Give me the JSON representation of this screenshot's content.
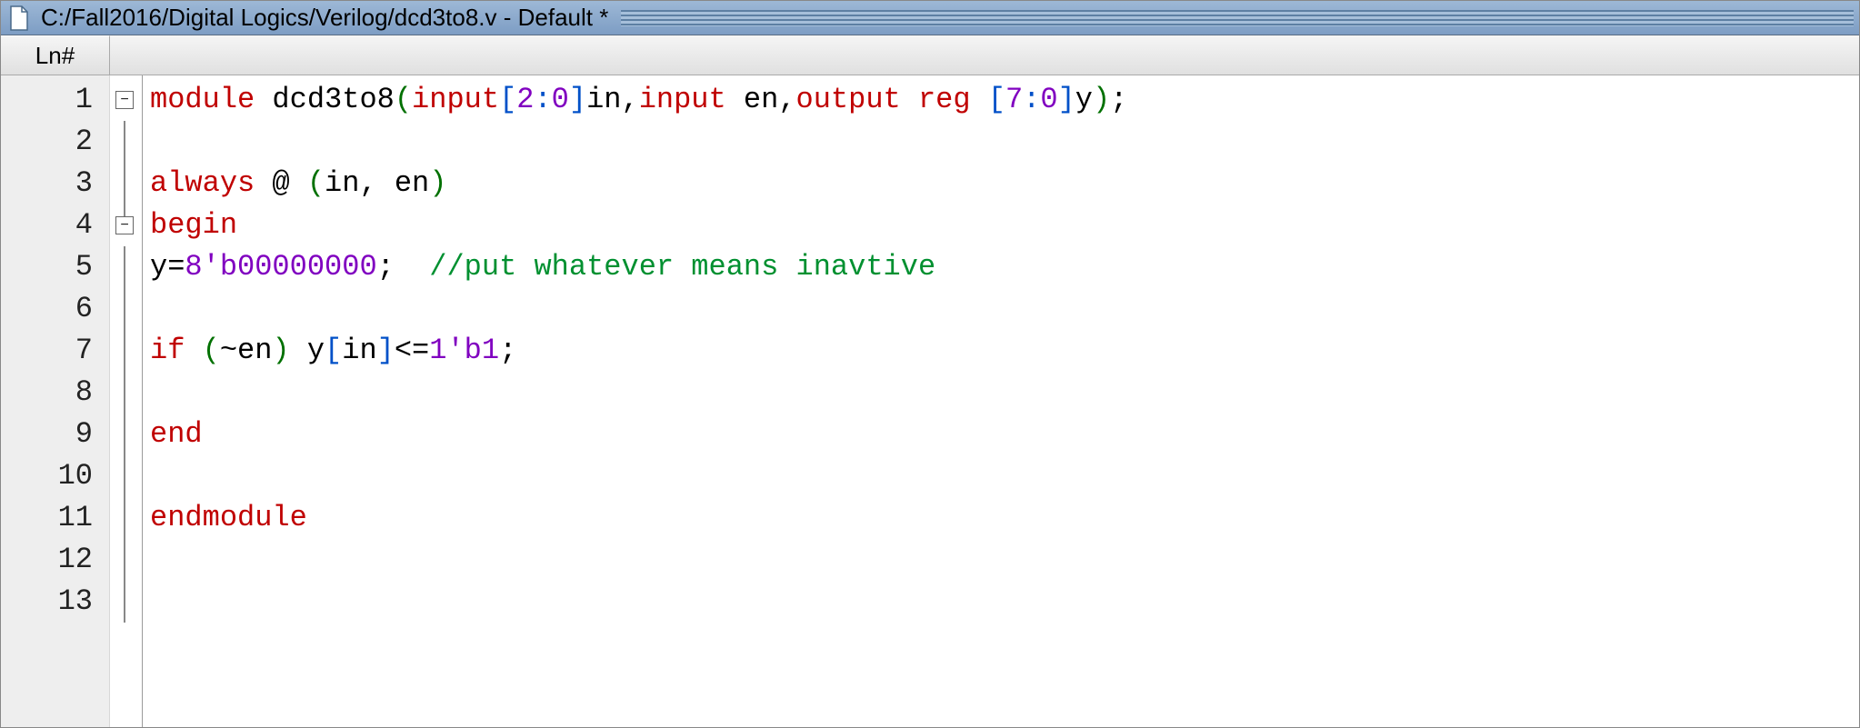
{
  "title": "C:/Fall2016/Digital Logics/Verilog/dcd3to8.v - Default *",
  "gutter_header": "Ln#",
  "line_numbers": [
    "1",
    "2",
    "3",
    "4",
    "5",
    "6",
    "7",
    "8",
    "9",
    "10",
    "11",
    "12",
    "13"
  ],
  "fold": {
    "line1": "−",
    "line4": "−"
  },
  "code": {
    "l1": {
      "module": "module",
      "sp1": " ",
      "name": "dcd3to8",
      "po": "(",
      "input1": "input",
      "b1o": "[",
      "r1a": "2",
      "colon1": ":",
      "r1b": "0",
      "b1c": "]",
      "in": "in",
      "comma1": ",",
      "input2": "input",
      "sp2": " ",
      "en": "en",
      "comma2": ",",
      "output": "output",
      "sp3": " ",
      "reg": "reg",
      "sp4": " ",
      "b2o": "[",
      "r2a": "7",
      "colon2": ":",
      "r2b": "0",
      "b2c": "]",
      "y": "y",
      "pc": ")",
      "semi": ";"
    },
    "l3": {
      "always": "always",
      "sp1": " ",
      "at": "@",
      "sp2": " ",
      "po": "(",
      "in": "in",
      "comma": ",",
      "sp3": " ",
      "en": "en",
      "pc": ")"
    },
    "l4": {
      "begin": "begin"
    },
    "l5": {
      "y": "y",
      "eq": "=",
      "lit": "8'b00000000",
      "semi": ";",
      "pad": "  ",
      "comment": "//put whatever means inavtive"
    },
    "l7": {
      "if": "if",
      "sp1": " ",
      "po": "(",
      "tilde": "~",
      "en": "en",
      "pc": ")",
      "sp2": " ",
      "y": "y",
      "bo": "[",
      "in": "in",
      "bc": "]",
      "le": "<=",
      "lit": "1'b1",
      "semi": ";"
    },
    "l9": {
      "end": "end"
    },
    "l11": {
      "endmodule": "endmodule"
    }
  }
}
